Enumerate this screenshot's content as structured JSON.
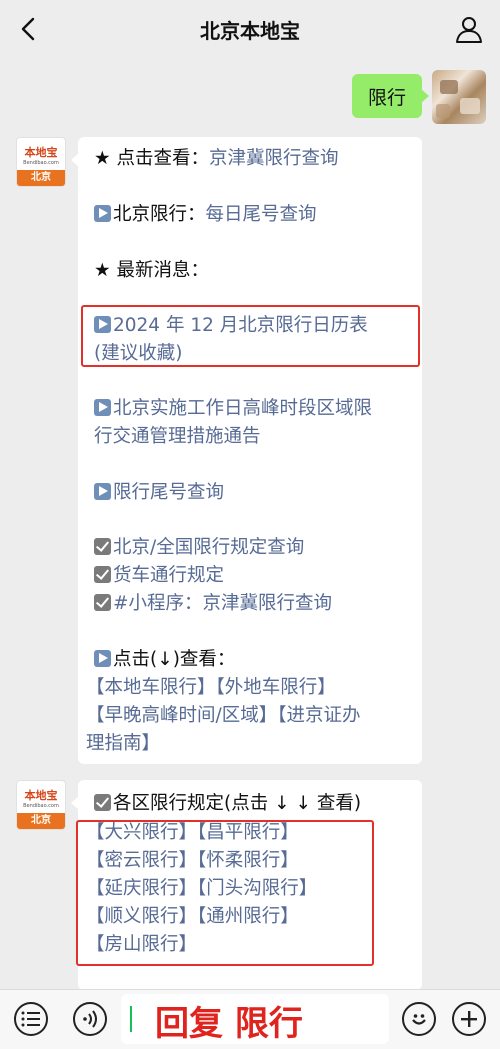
{
  "header": {
    "title": "北京本地宝",
    "back_icon": "chevron-left-icon",
    "profile_icon": "person-icon"
  },
  "user_message": {
    "text": "限行"
  },
  "bot": {
    "logo_brand": "本地宝",
    "logo_url": "Bendibao.com",
    "logo_city": "北京"
  },
  "message1": {
    "line1_prefix": "★ 点击查看：",
    "line1_link": "京津冀限行查询",
    "line2_prefix": "北京限行：",
    "line2_link": "每日尾号查询",
    "line3": "★ 最新消息：",
    "line4a": "2024 年 12 月北京限行日历表",
    "line4b": "(建议收藏)",
    "line5a": "北京实施工作日高峰时段区域限",
    "line5b": "行交通管理措施通告",
    "line6": "限行尾号查询",
    "line7": "北京/全国限行规定查询",
    "line8": "货车通行规定",
    "line9_prefix": "#小程序：",
    "line9_link": "京津冀限行查询",
    "line10": "点击(↓)查看：",
    "line11": "【本地车限行】【外地车限行】",
    "line12": "【早晚高峰时间/区域】【进京证办",
    "line13": "理指南】"
  },
  "message2": {
    "heading": "各区限行规定(点击 ↓ ↓ 查看)",
    "rows": [
      "【大兴限行】【昌平限行】",
      "【密云限行】【怀柔限行】",
      "【延庆限行】【门头沟限行】",
      "【顺义限行】【通州限行】",
      "【房山限行】"
    ]
  },
  "input_bar": {
    "text": "回复 限行"
  },
  "colors": {
    "link": "#576b95",
    "user_bubble": "#95ec69",
    "highlight_box": "#e0312a",
    "input_text": "#e0231d"
  }
}
